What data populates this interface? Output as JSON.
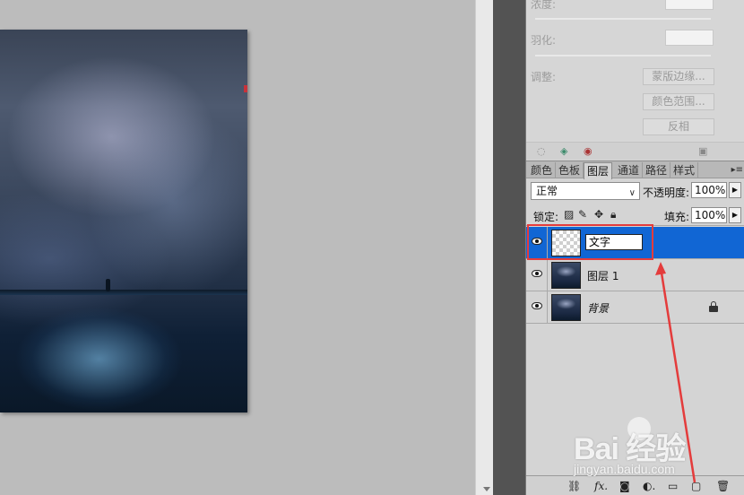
{
  "masks_panel": {
    "density_label": "浓度:",
    "feather_label": "羽化:",
    "refine_label": "调整:",
    "buttons": [
      "蒙版边缘...",
      "颜色范围...",
      "反相"
    ]
  },
  "layers_panel": {
    "tabs": [
      "颜色",
      "色板",
      "图层",
      "通道",
      "路径",
      "样式"
    ],
    "active_tab": "图层",
    "blend_mode": "正常",
    "opacity_label": "不透明度:",
    "opacity_value": "100%",
    "lock_label": "锁定:",
    "fill_label": "填充:",
    "fill_value": "100%",
    "layers": [
      {
        "name": "文字",
        "editing": true,
        "selected": true,
        "thumb": "transparent"
      },
      {
        "name": "图层 1",
        "editing": false,
        "selected": false,
        "thumb": "galaxy"
      },
      {
        "name": "背景",
        "editing": false,
        "selected": false,
        "thumb": "galaxy",
        "locked": true
      }
    ],
    "bottom_icons": [
      "link-icon",
      "fx-icon",
      "mask-icon",
      "adjustment-icon",
      "group-icon",
      "new-layer-icon",
      "trash-icon"
    ]
  },
  "watermark": {
    "brand": "Bai  经验",
    "url": "jingyan.baidu.com"
  },
  "colors": {
    "selection": "#1166d4",
    "annotation": "#e43c3c",
    "panel_bg": "#d4d4d4"
  }
}
